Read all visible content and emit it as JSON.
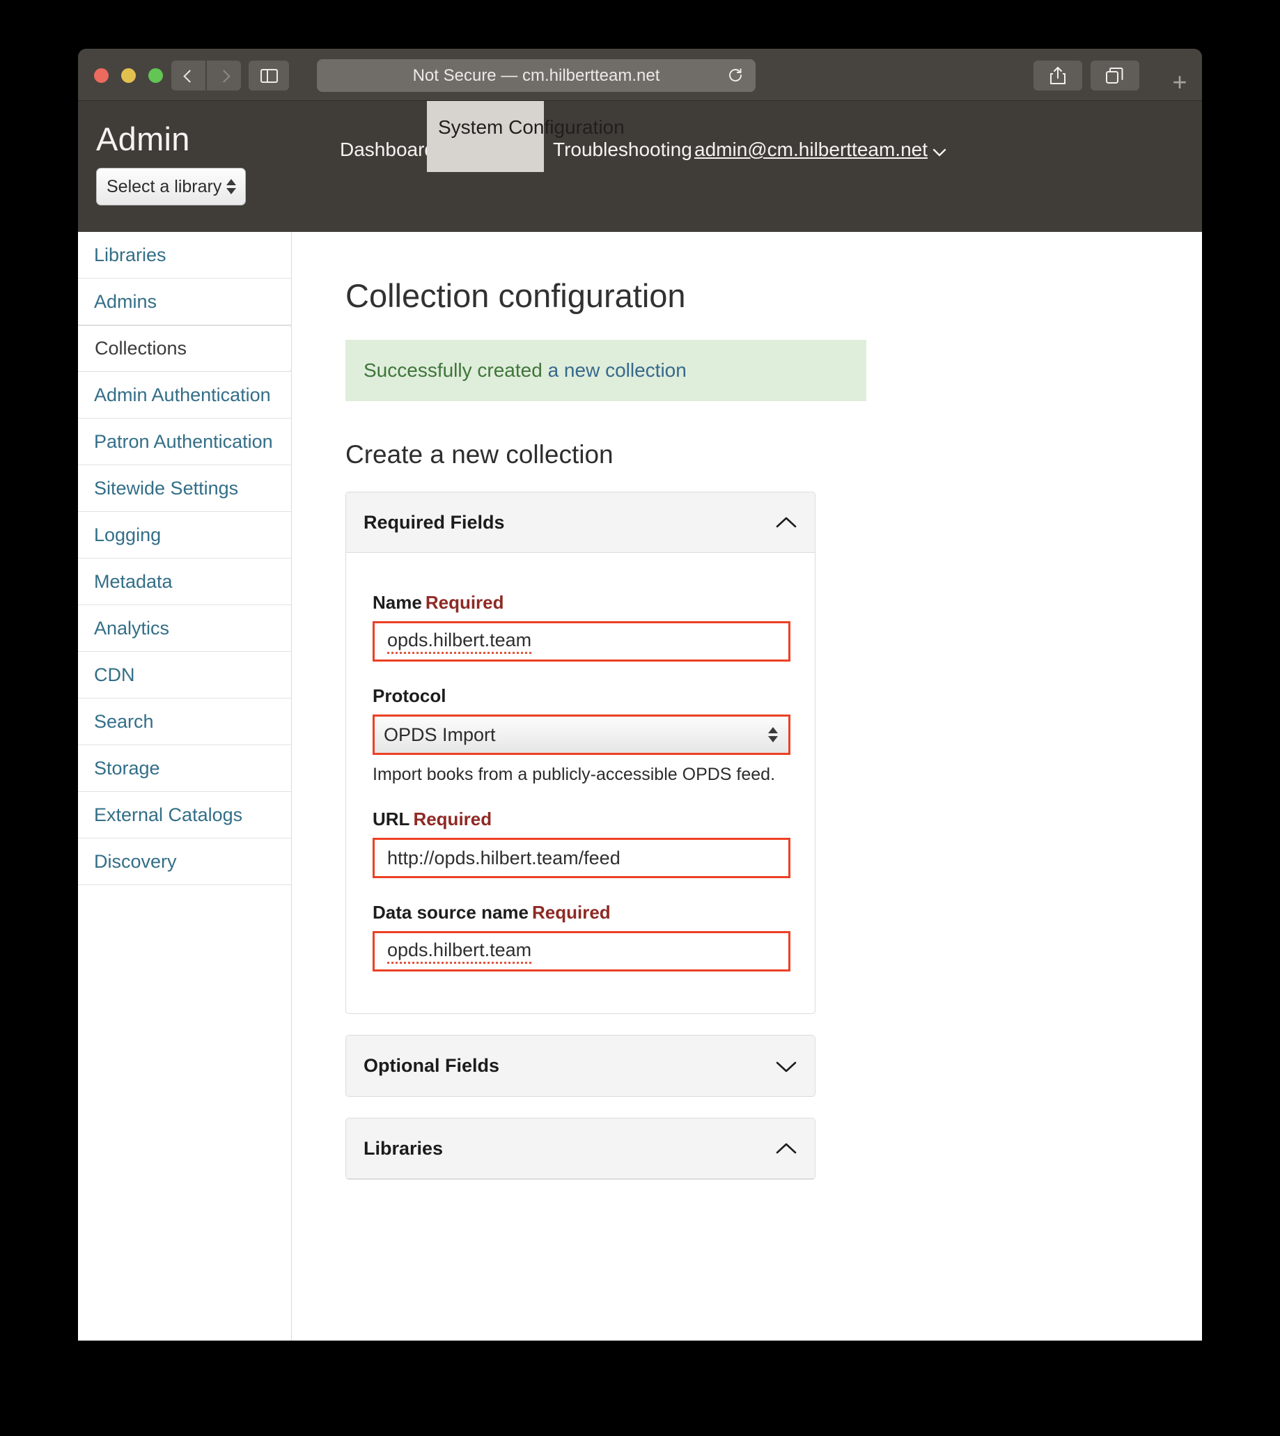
{
  "browser": {
    "url_status": "Not Secure",
    "url_separator": "—",
    "url_host": "cm.hilbertteam.net",
    "url_full": "Not Secure — cm.hilbertteam.net",
    "icons": {
      "back": "back-chevron-icon",
      "forward": "forward-chevron-icon",
      "sidebar": "sidebar-toggle-icon",
      "reload": "reload-icon",
      "share": "share-icon",
      "tabs": "tab-overview-icon",
      "new_tab": "+"
    }
  },
  "header": {
    "app_title": "Admin",
    "library_select": {
      "value": "Select a library"
    },
    "nav": {
      "dashboard": "Dashboard",
      "system_configuration": "System Configuration",
      "troubleshooting": "Troubleshooting",
      "user_email": "admin@cm.hilbertteam.net"
    }
  },
  "sidebar": {
    "items": [
      {
        "label": "Libraries",
        "active": false
      },
      {
        "label": "Admins",
        "active": false
      },
      {
        "label": "Collections",
        "active": true
      },
      {
        "label": "Admin Authentication",
        "active": false
      },
      {
        "label": "Patron Authentication",
        "active": false
      },
      {
        "label": "Sitewide Settings",
        "active": false
      },
      {
        "label": "Logging",
        "active": false
      },
      {
        "label": "Metadata",
        "active": false
      },
      {
        "label": "Analytics",
        "active": false
      },
      {
        "label": "CDN",
        "active": false
      },
      {
        "label": "Search",
        "active": false
      },
      {
        "label": "Storage",
        "active": false
      },
      {
        "label": "External Catalogs",
        "active": false
      },
      {
        "label": "Discovery",
        "active": false
      }
    ]
  },
  "main": {
    "page_title": "Collection configuration",
    "alert": {
      "text": "Successfully created",
      "link_text": "a new collection"
    },
    "section_title": "Create a new collection",
    "panels": {
      "required": {
        "title": "Required Fields",
        "expanded": true,
        "caret": "chevron-up-icon"
      },
      "optional": {
        "title": "Optional Fields",
        "expanded": false,
        "caret": "chevron-down-icon"
      },
      "libraries": {
        "title": "Libraries",
        "expanded": true,
        "caret": "chevron-up-icon"
      }
    },
    "fields": {
      "name": {
        "label": "Name",
        "required_tag": "Required",
        "value": "opds.hilbert.team"
      },
      "protocol": {
        "label": "Protocol",
        "value": "OPDS Import",
        "help": "Import books from a publicly-accessible OPDS feed."
      },
      "url": {
        "label": "URL",
        "required_tag": "Required",
        "value": "http://opds.hilbert.team/feed"
      },
      "data_source_name": {
        "label": "Data source name",
        "required_tag": "Required",
        "value": "opds.hilbert.team"
      }
    }
  },
  "colors": {
    "chrome": "#403d39",
    "link": "#336e87",
    "success_bg": "#dfeddb",
    "success_text": "#3f7539",
    "required_border": "#ec4024",
    "required_label": "#8e2a24"
  }
}
